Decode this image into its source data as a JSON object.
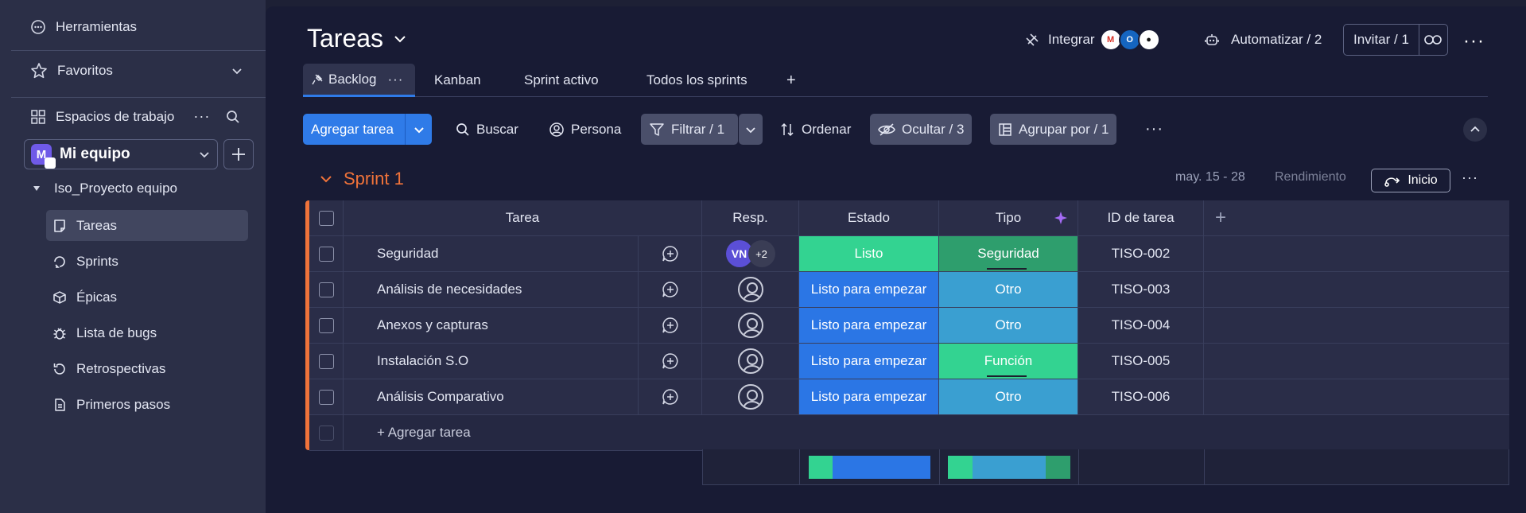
{
  "sidebar": {
    "tools": "Herramientas",
    "favorites": "Favoritos",
    "workspaces": "Espacios de trabajo",
    "workspace": {
      "initial": "M",
      "name": "Mi equipo"
    },
    "project": "Iso_Proyecto equipo",
    "items": [
      {
        "label": "Tareas",
        "icon": "board-icon",
        "active": true
      },
      {
        "label": "Sprints",
        "icon": "sprints-icon"
      },
      {
        "label": "Épicas",
        "icon": "cube-icon"
      },
      {
        "label": "Lista de bugs",
        "icon": "bug-icon"
      },
      {
        "label": "Retrospectivas",
        "icon": "retro-icon"
      },
      {
        "label": "Primeros pasos",
        "icon": "doc-icon"
      }
    ]
  },
  "header": {
    "title": "Tareas",
    "integrate": "Integrar",
    "automate": "Automatizar / 2",
    "invite": "Invitar / 1"
  },
  "tabs": [
    {
      "label": "Backlog",
      "active": true
    },
    {
      "label": "Kanban"
    },
    {
      "label": "Sprint activo"
    },
    {
      "label": "Todos los sprints"
    }
  ],
  "toolbar": {
    "add_task": "Agregar tarea",
    "search": "Buscar",
    "person": "Persona",
    "filter": "Filtrar / 1",
    "sort": "Ordenar",
    "hide": "Ocultar / 3",
    "group_by": "Agrupar por / 1"
  },
  "sprint": {
    "name": "Sprint 1",
    "dates": "may. 15 - 28",
    "performance": "Rendimiento",
    "start": "Inicio"
  },
  "table": {
    "columns": {
      "task": "Tarea",
      "resp": "Resp.",
      "status": "Estado",
      "type": "Tipo",
      "id": "ID de tarea"
    },
    "rows": [
      {
        "task": "Seguridad",
        "resp": "VN",
        "resp_more": "+2",
        "status": "Listo",
        "status_color": "#33d391",
        "type": "Seguridad",
        "type_color": "#2e9e6d",
        "id": "TISO-002"
      },
      {
        "task": "Análisis de necesidades",
        "status": "Listo para empezar",
        "status_color": "#2b76e5",
        "type": "Otro",
        "type_color": "#3a9fd1",
        "id": "TISO-003"
      },
      {
        "task": "Anexos y capturas",
        "status": "Listo para empezar",
        "status_color": "#2b76e5",
        "type": "Otro",
        "type_color": "#3a9fd1",
        "id": "TISO-004"
      },
      {
        "task": "Instalación S.O",
        "status": "Listo para empezar",
        "status_color": "#2b76e5",
        "type": "Función",
        "type_color": "#33d391",
        "id": "TISO-005"
      },
      {
        "task": "Análisis Comparativo",
        "status": "Listo para empezar",
        "status_color": "#2b76e5",
        "type": "Otro",
        "type_color": "#3a9fd1",
        "id": "TISO-006"
      }
    ],
    "add_task": "+ Agregar tarea"
  }
}
